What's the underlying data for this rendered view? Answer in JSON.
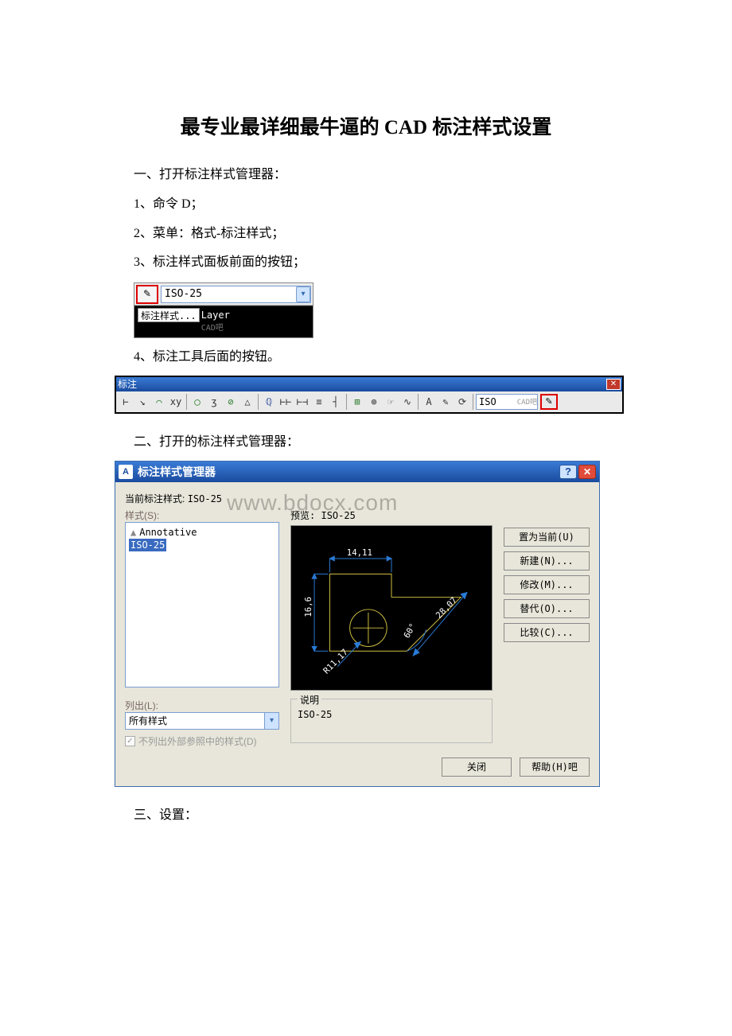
{
  "document": {
    "title": "最专业最详细最牛逼的 CAD 标注样式设置",
    "sec1": "一、打开标注样式管理器：",
    "sec1_item1": "1、命令 D；",
    "sec1_item2": "2、菜单：格式-标注样式；",
    "sec1_item3": "3、标注样式面板前面的按钮；",
    "sec1_item4": "4、标注工具后面的按钮。",
    "sec2": "二、打开的标注样式管理器：",
    "sec3": "三、设置："
  },
  "shot1": {
    "dropdown_value": "ISO-25",
    "icon_glyph": "✎",
    "tooltip1": "标注样式...",
    "tooltip2": "Layer",
    "tag": "CAD吧"
  },
  "shot2": {
    "title": "标注",
    "dropdown_value": "ISO",
    "watermark": "CAD吧"
  },
  "dialog": {
    "title": "标注样式管理器",
    "current_style_label": "当前标注样式",
    "current_style": "ISO-25",
    "styles_label": "样式(S):",
    "preview_label": "预览",
    "preview_style": "ISO-25",
    "list": {
      "annotative": "Annotative",
      "iso25": "ISO-25"
    },
    "buttons": {
      "set_current": "置为当前(U)",
      "new": "新建(N)...",
      "modify": "修改(M)...",
      "override": "替代(O)...",
      "compare": "比较(C)..."
    },
    "list_filter_label": "列出(L):",
    "list_filter_value": "所有样式",
    "checkbox_label": "不列出外部参照中的样式(D)",
    "desc_group_label": "说明",
    "desc_value": "ISO-25",
    "close": "关闭",
    "help": "帮助(H)吧",
    "preview_dims": {
      "top": "14,11",
      "left": "16,6",
      "diag": "28,07",
      "angle": "60°",
      "radius": "R11,17"
    },
    "watermark": "www.bdocx.com"
  }
}
